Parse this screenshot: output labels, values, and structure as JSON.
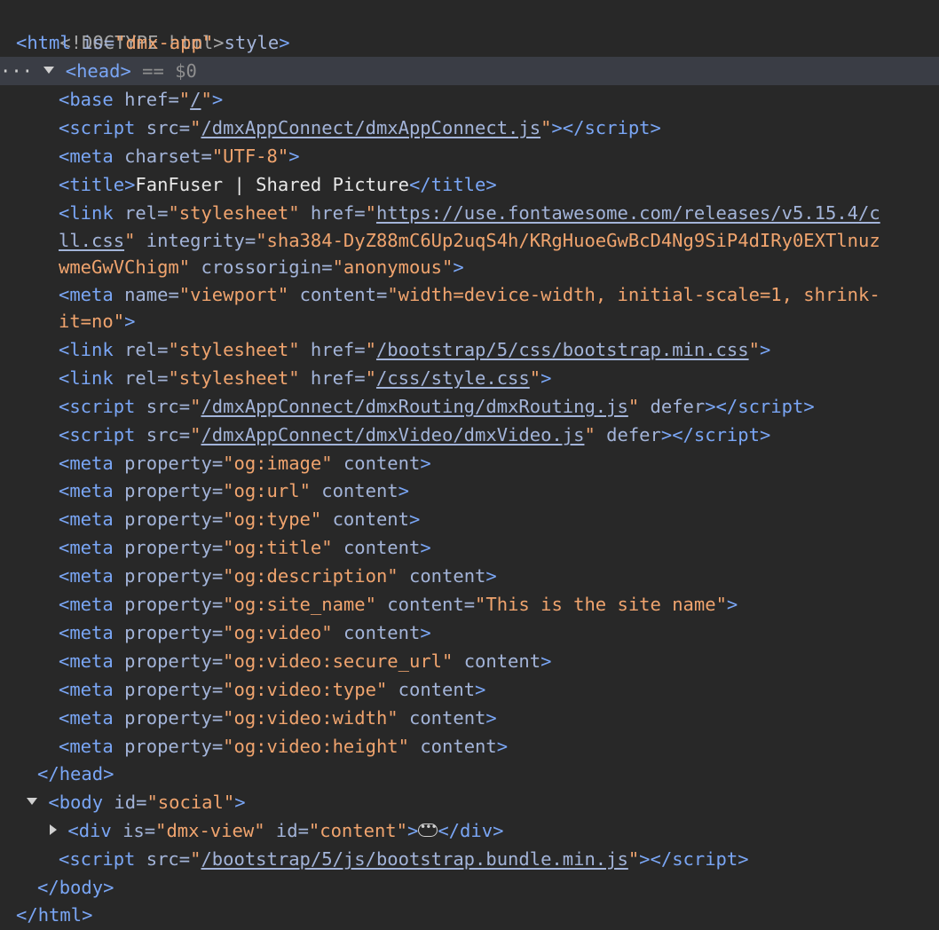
{
  "lines": {
    "l0": "<!DOCTYPE html>",
    "html_is": "dmx-app",
    "base_href": "/",
    "script1_src": "/dmxAppConnect/dmxAppConnect.js",
    "meta_charset": "UTF-8",
    "title_text": "FanFuser | Shared Picture",
    "link1_rel": "stylesheet",
    "link1_href": "https://use.fontawesome.com/releases/v5.15.4/c",
    "link1_href_cont": "ll.css",
    "link1_integrity": "sha384-DyZ88mC6Up2uqS4h/KRgHuoeGwBcD4Ng9SiP4dIRy0EXTlnuz",
    "link1_integrity_cont": "wmeGwVChigm",
    "link1_crossorigin": "anonymous",
    "viewport_name": "viewport",
    "viewport_content": "width=device-width, initial-scale=1, shrink-",
    "viewport_content_cont": "it=no",
    "link2_rel": "stylesheet",
    "link2_href": "/bootstrap/5/css/bootstrap.min.css",
    "link3_rel": "stylesheet",
    "link3_href": "/css/style.css",
    "script2_src": "/dmxAppConnect/dmxRouting/dmxRouting.js",
    "script3_src": "/dmxAppConnect/dmxVideo/dmxVideo.js",
    "og_image": "og:image",
    "og_url": "og:url",
    "og_type": "og:type",
    "og_title": "og:title",
    "og_description": "og:description",
    "og_site_name": "og:site_name",
    "og_site_name_content": "This is the site name",
    "og_video": "og:video",
    "og_video_secure": "og:video:secure_url",
    "og_video_type": "og:video:type",
    "og_video_width": "og:video:width",
    "og_video_height": "og:video:height",
    "body_id": "social",
    "div_is": "dmx-view",
    "div_id": "content",
    "script4_src": "/bootstrap/5/js/bootstrap.bundle.min.js"
  },
  "tokens": {
    "html_tag": "html",
    "head_tag": "head",
    "body_tag": "body",
    "base_tag": "base",
    "script_tag": "script",
    "meta_tag": "meta",
    "title_tag": "title",
    "link_tag": "link",
    "div_tag": "div",
    "attr_is": "is",
    "attr_style": "style",
    "attr_href": "href",
    "attr_src": "src",
    "attr_charset": "charset",
    "attr_rel": "rel",
    "attr_integrity": "integrity",
    "attr_crossorigin": "crossorigin",
    "attr_name": "name",
    "attr_content": "content",
    "attr_property": "property",
    "attr_defer": "defer",
    "attr_id": "id",
    "selected_marker": "== $0"
  },
  "colors": {
    "background": "#282828",
    "selected_line": "#3a3d45",
    "tag": "#7aa6f5",
    "attribute": "#a3b4d9",
    "value": "#f0a46e",
    "text": "#e8e8e8"
  }
}
